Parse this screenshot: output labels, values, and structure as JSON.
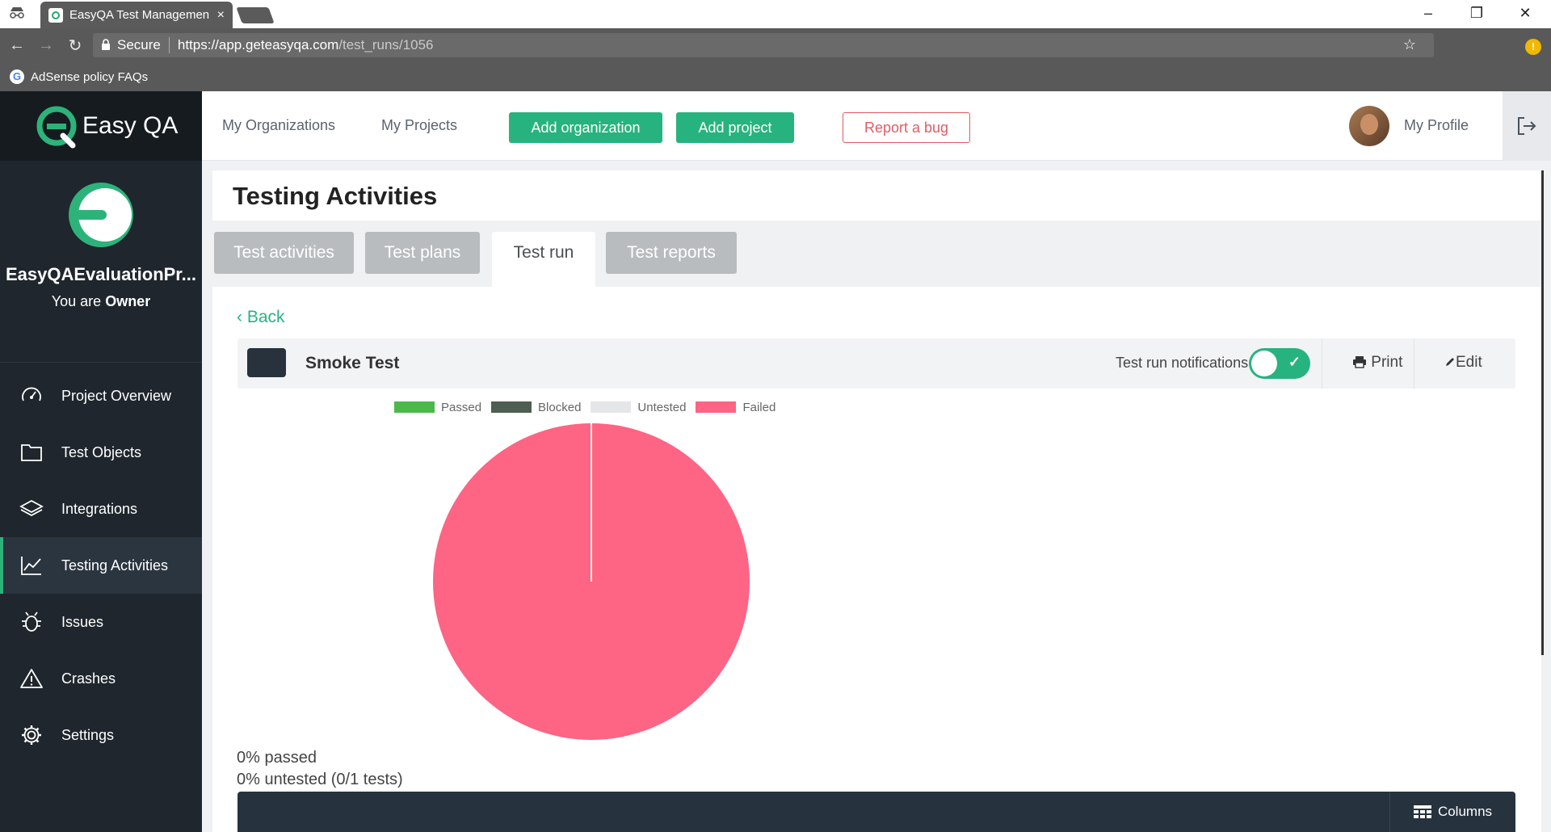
{
  "browser": {
    "tab_title": "EasyQA Test Managemen",
    "tab_close": "×",
    "secure_label": "Secure",
    "url_scheme_host": "https://app.geteasyqa.com",
    "url_path": "/test_runs/1056",
    "bookmark_label": "AdSense policy FAQs",
    "bookmark_icon": "G",
    "window_min": "–",
    "window_restore": "❐",
    "window_close": "✕",
    "nav_back": "←",
    "nav_forward": "→",
    "nav_reload": "↻",
    "star": "☆",
    "extension_badge": "!"
  },
  "app": {
    "brand_name": "Easy QA",
    "accent_color": "#27b37f"
  },
  "sidebar": {
    "project_name": "EasyQAEvaluationPr...",
    "role_prefix": "You are ",
    "role": "Owner",
    "items": [
      {
        "label": "Project Overview",
        "icon": "gauge-icon"
      },
      {
        "label": "Test Objects",
        "icon": "folder-icon"
      },
      {
        "label": "Integrations",
        "icon": "layers-icon"
      },
      {
        "label": "Testing Activities",
        "icon": "chart-line-icon",
        "active": true
      },
      {
        "label": "Issues",
        "icon": "bug-icon"
      },
      {
        "label": "Crashes",
        "icon": "warning-icon"
      },
      {
        "label": "Settings",
        "icon": "gear-icon"
      }
    ]
  },
  "header": {
    "my_organizations": "My Organizations",
    "my_projects": "My Projects",
    "add_organization": "Add organization",
    "add_project": "Add project",
    "report_bug": "Report a bug",
    "my_profile": "My Profile"
  },
  "page": {
    "title": "Testing Activities",
    "tabs": [
      "Test activities",
      "Test plans",
      "Test run",
      "Test reports"
    ],
    "active_tab": "Test run",
    "back": "Back",
    "run_name": "Smoke Test",
    "run_color": "#27323d",
    "notifications_label": "Test run notifications",
    "notifications_on": true,
    "print": "Print",
    "edit": "Edit",
    "passed_summary": "0% passed",
    "untested_summary": "0% untested (0/1 tests)",
    "columns": "Columns"
  },
  "chart_data": {
    "type": "pie",
    "title": "",
    "legend_position": "top",
    "series": [
      {
        "name": "Passed",
        "value": 0,
        "color": "#4cb84c"
      },
      {
        "name": "Blocked",
        "value": 0,
        "color": "#4e5e52"
      },
      {
        "name": "Untested",
        "value": 0,
        "color": "#e5e6e8"
      },
      {
        "name": "Failed",
        "value": 1,
        "color": "#fe6483"
      }
    ]
  }
}
